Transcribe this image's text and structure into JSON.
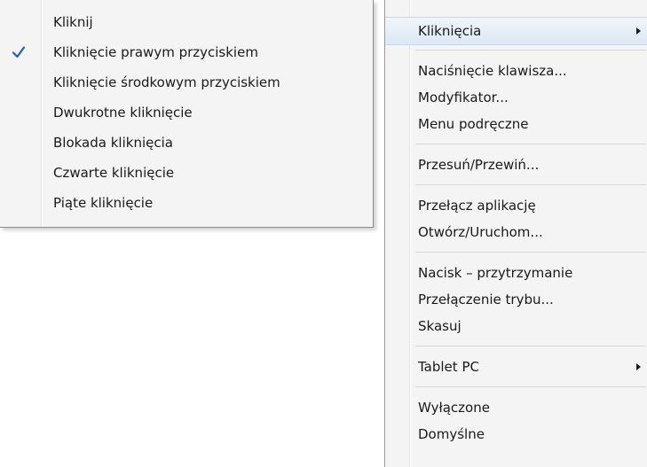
{
  "submenu": {
    "items": [
      {
        "label": "Kliknij",
        "checked": false
      },
      {
        "label": "Kliknięcie prawym przyciskiem",
        "checked": true
      },
      {
        "label": "Kliknięcie środkowym przyciskiem",
        "checked": false
      },
      {
        "label": "Dwukrotne kliknięcie",
        "checked": false
      },
      {
        "label": "Blokada kliknięcia",
        "checked": false
      },
      {
        "label": "Czwarte kliknięcie",
        "checked": false
      },
      {
        "label": "Piąte kliknięcie",
        "checked": false
      }
    ],
    "check_icon": "checkmark-icon",
    "check_color": "#1f5fbf"
  },
  "mainmenu": {
    "groups": [
      [
        {
          "label": "Kliknięcia",
          "submenu": true,
          "highlighted": true
        }
      ],
      [
        {
          "label": "Naciśnięcie klawisza..."
        },
        {
          "label": "Modyfikator..."
        },
        {
          "label": "Menu podręczne"
        }
      ],
      [
        {
          "label": "Przesuń/Przewiń..."
        }
      ],
      [
        {
          "label": "Przełącz aplikację"
        },
        {
          "label": "Otwórz/Uruchom..."
        }
      ],
      [
        {
          "label": "Nacisk – przytrzymanie"
        },
        {
          "label": "Przełączenie trybu..."
        },
        {
          "label": "Skasuj"
        }
      ],
      [
        {
          "label": "Tablet PC",
          "submenu": true
        }
      ],
      [
        {
          "label": "Wyłączone"
        },
        {
          "label": "Domyślne"
        }
      ]
    ],
    "arrow_icon": "chevron-right-icon",
    "highlight_color": "#dce8f5"
  }
}
